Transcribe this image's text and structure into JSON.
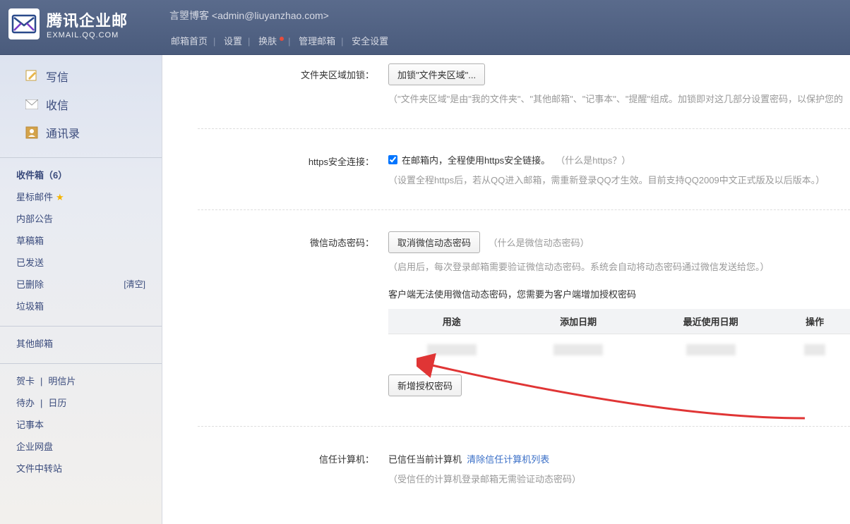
{
  "header": {
    "logo_cn": "腾讯企业邮",
    "logo_en": "EXMAIL.QQ.COM",
    "user": "言曌博客 <admin@liuyanzhao.com>",
    "nav": [
      "邮箱首页",
      "设置",
      "换肤",
      "管理邮箱",
      "安全设置"
    ]
  },
  "sidebar": {
    "main": [
      {
        "icon": "compose",
        "label": "写信"
      },
      {
        "icon": "inbox",
        "label": "收信"
      },
      {
        "icon": "contacts",
        "label": "通讯录"
      }
    ],
    "folders": [
      {
        "label": "收件箱（6）",
        "bold": true
      },
      {
        "label": "星标邮件",
        "star": true
      },
      {
        "label": "内部公告"
      },
      {
        "label": "草稿箱"
      },
      {
        "label": "已发送"
      },
      {
        "label": "已删除",
        "clear": "[清空]"
      },
      {
        "label": "垃圾箱"
      }
    ],
    "other_label": "其他邮箱",
    "tools1": [
      "贺卡",
      "明信片"
    ],
    "tools2": [
      "待办",
      "日历"
    ],
    "tools3": [
      "记事本"
    ],
    "tools4": [
      "企业网盘"
    ],
    "tools5": [
      "文件中转站"
    ]
  },
  "settings": {
    "folder_lock": {
      "label": "文件夹区域加锁：",
      "button": "加锁\"文件夹区域\"...",
      "hint": "（\"文件夹区域\"是由\"我的文件夹\"、\"其他邮箱\"、\"记事本\"、\"提醒\"组成。加锁即对这几部分设置密码，以保护您的"
    },
    "https": {
      "label": "https安全连接：",
      "checkbox_label": "在邮箱内，全程使用https安全链接。",
      "what_link": "（什么是https？）",
      "hint": "（设置全程https后，若从QQ进入邮箱，需重新登录QQ才生效。目前支持QQ2009中文正式版及以后版本。）"
    },
    "wechat": {
      "label": "微信动态密码：",
      "button": "取消微信动态密码",
      "what_link": "（什么是微信动态密码）",
      "hint": "（启用后，每次登录邮箱需要验证微信动态密码。系统会自动将动态密码通过微信发送给您。）",
      "client_note": "客户端无法使用微信动态密码，您需要为客户端增加授权密码",
      "table_headers": [
        "用途",
        "添加日期",
        "最近使用日期",
        "操作"
      ],
      "add_button": "新增授权密码"
    },
    "trust": {
      "label": "信任计算机：",
      "status": "已信任当前计算机",
      "clear_link": "清除信任计算机列表",
      "hint": "（受信任的计算机登录邮箱无需验证动态密码）"
    }
  }
}
